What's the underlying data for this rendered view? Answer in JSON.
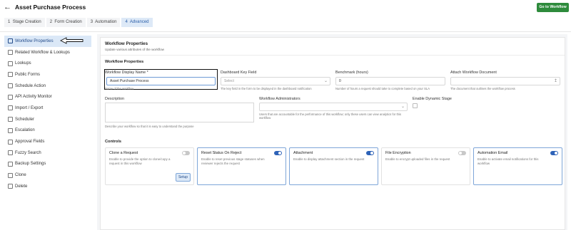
{
  "header": {
    "back_icon": "arrow-left-icon",
    "title": "Asset Purchase Process",
    "go_button": "Go to Workflow",
    "go_button_color": "#2e8b3c"
  },
  "tabs": [
    {
      "num": "1",
      "label": "Stage Creation",
      "active": false
    },
    {
      "num": "2",
      "label": "Form Creation",
      "active": false
    },
    {
      "num": "3",
      "label": "Automation",
      "active": false
    },
    {
      "num": "4",
      "label": "Advanced",
      "active": true
    }
  ],
  "sidebar": {
    "items": [
      {
        "label": "Workflow Properties",
        "icon": "edit-icon",
        "active": true
      },
      {
        "label": "Related Workflow & Lookups",
        "icon": "link-icon"
      },
      {
        "label": "Lookups",
        "icon": "list-icon"
      },
      {
        "label": "Public Forms",
        "icon": "form-icon"
      },
      {
        "label": "Schedule Action",
        "icon": "calendar-icon"
      },
      {
        "label": "API Activity Monitor",
        "icon": "monitor-icon"
      },
      {
        "label": "Import / Export",
        "icon": "import-export-icon"
      },
      {
        "label": "Scheduler",
        "icon": "clock-icon"
      },
      {
        "label": "Escalation",
        "icon": "escalation-icon"
      },
      {
        "label": "Approval Fields",
        "icon": "check-icon"
      },
      {
        "label": "Fuzzy Search",
        "icon": "search-icon"
      },
      {
        "label": "Backup Settings",
        "icon": "backup-icon"
      },
      {
        "label": "Clone",
        "icon": "clone-icon"
      },
      {
        "label": "Delete",
        "icon": "trash-icon"
      }
    ]
  },
  "main": {
    "title": "Workflow Properties",
    "subtitle": "Update various attributes of the workflow",
    "section": "Workflow Properties",
    "fields": {
      "display_name": {
        "label": "Workflow Display Name *",
        "value": "Asset Purchase Process",
        "hint": "Name of the workflow"
      },
      "dashboard_key": {
        "label": "Dashboard Key Field",
        "placeholder": "Select",
        "hint": "The key field in the form to be displayed in the dashboard notification"
      },
      "benchmark": {
        "label": "Benchmark (hours)",
        "value": "0",
        "hint": "Number of hours a request should take to complete based on your SLA"
      },
      "attach_doc": {
        "label": "Attach Workflow Document",
        "hint": "The document that outlines the workflow process"
      },
      "description": {
        "label": "Description",
        "hint": "Describe your workflow so that it is easy to understand the purpose"
      },
      "administrators": {
        "label": "Workflow Administrators",
        "hint": "Users that are accountable for the performance of this workflow; only these users can view analytics for this workflow"
      },
      "dynamic_stage": {
        "label": "Enable Dynamic Stage"
      }
    },
    "controls_title": "Controls",
    "controls": [
      {
        "title": "Clone a Request",
        "desc": "Enable to provide the option to clone/copy a request in this workflow",
        "on": false,
        "button": "Setup"
      },
      {
        "title": "Reset Status On Reject",
        "desc": "Enable to reset previous stage statuses when reviewer rejects the request",
        "on": true
      },
      {
        "title": "Attachment",
        "desc": "Enable to display attachment section in the request",
        "on": true
      },
      {
        "title": "File Encryption",
        "desc": "Enable to encrypt uploaded files in the request",
        "on": false
      },
      {
        "title": "Automation Email",
        "desc": "Enable to activate email notifications for this workflow",
        "on": true
      }
    ]
  }
}
